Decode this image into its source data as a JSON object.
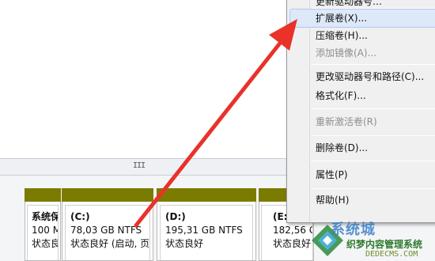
{
  "context_menu": {
    "items": [
      {
        "label": "更新驱动器号…",
        "enabled": true,
        "partial": true
      },
      {
        "label": "扩展卷(X)...",
        "enabled": true,
        "highlighted": true
      },
      {
        "label": "压缩卷(H)...",
        "enabled": true
      },
      {
        "label": "添加镜像(A)...",
        "enabled": false
      },
      {
        "label": "更改驱动器号和路径(C)...",
        "enabled": true
      },
      {
        "label": "格式化(F)...",
        "enabled": true
      },
      {
        "label": "重新激活卷(R)",
        "enabled": false
      },
      {
        "label": "删除卷(D)...",
        "enabled": true
      },
      {
        "label": "属性(P)",
        "enabled": true
      },
      {
        "label": "帮助(H)",
        "enabled": true
      }
    ]
  },
  "splitter": {
    "grip": "III"
  },
  "partitions": [
    {
      "name": "系统保",
      "size": "100 M",
      "status": "状态良好"
    },
    {
      "name": "(C:)",
      "size": "78,03 GB NTFS",
      "status": "状态良好 (启动, 页"
    },
    {
      "name": "(D:)",
      "size": "195,31 GB NTFS",
      "status": "状态良好"
    },
    {
      "name": "(E:",
      "size": "182,56 GB",
      "status": "状态良好"
    }
  ],
  "watermark": {
    "main": "系统城",
    "sub": "织梦内容管理系统",
    "url": "DEDECMS.COM",
    "url2": "xitongcheng.com"
  },
  "colors": {
    "partition_bar": "#7b7b00",
    "menu_highlight": "#dde8f8",
    "arrow": "#e8322a"
  }
}
